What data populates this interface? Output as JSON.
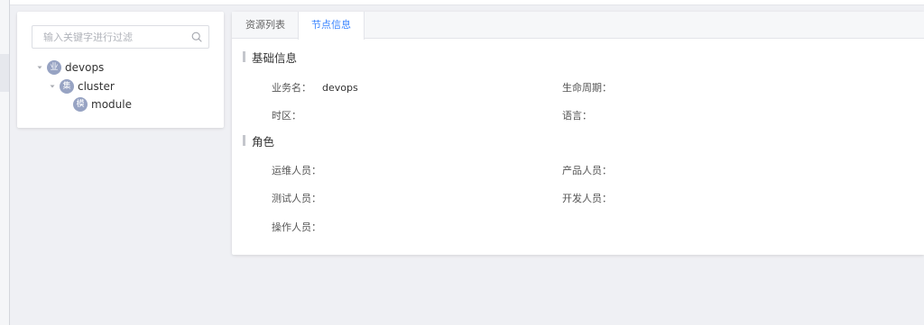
{
  "tree": {
    "search_placeholder": "输入关键字进行过滤",
    "nodes": [
      {
        "badge": "业",
        "label": "devops"
      },
      {
        "badge": "集",
        "label": "cluster"
      },
      {
        "badge": "模",
        "label": "module"
      }
    ]
  },
  "tabs": [
    {
      "label": "资源列表",
      "active": false
    },
    {
      "label": "节点信息",
      "active": true
    }
  ],
  "basic_info": {
    "title": "基础信息",
    "fields": [
      {
        "label": "业务名：",
        "value": "devops"
      },
      {
        "label": "生命周期：",
        "value": ""
      },
      {
        "label": "时区：",
        "value": ""
      },
      {
        "label": "语言：",
        "value": ""
      }
    ]
  },
  "roles": {
    "title": "角色",
    "fields": [
      {
        "label": "运维人员：",
        "value": ""
      },
      {
        "label": "产品人员：",
        "value": ""
      },
      {
        "label": "测试人员：",
        "value": ""
      },
      {
        "label": "开发人员：",
        "value": ""
      },
      {
        "label": "操作人员：",
        "value": ""
      }
    ]
  },
  "colors": {
    "accent": "#3a84ff",
    "badge": "#97a3c3",
    "background": "#eff0f4"
  }
}
